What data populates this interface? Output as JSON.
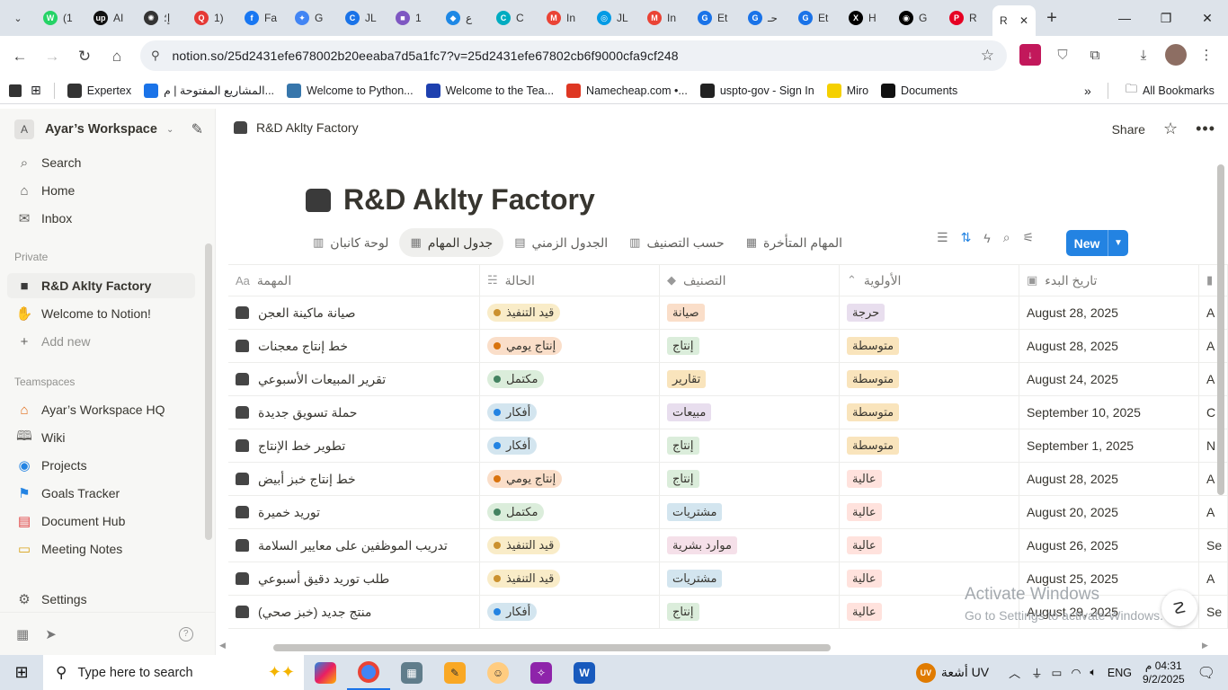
{
  "browser": {
    "tabs": [
      {
        "label": "(1",
        "color": "#25d366",
        "glyph": "W"
      },
      {
        "label": "AI",
        "color": "#111111",
        "glyph": "up"
      },
      {
        "label": "إ؛",
        "color": "#333333",
        "glyph": "✺"
      },
      {
        "label": "1)",
        "color": "#e53935",
        "glyph": "Q"
      },
      {
        "label": "Fa",
        "color": "#1877f2",
        "glyph": "f"
      },
      {
        "label": "G",
        "color": "#4285f4",
        "glyph": "✦"
      },
      {
        "label": "JL",
        "color": "#1a73e8",
        "glyph": "C"
      },
      {
        "label": "1",
        "color": "#7e57c2",
        "glyph": "■"
      },
      {
        "label": "ع",
        "color": "#1e88e5",
        "glyph": "◆"
      },
      {
        "label": "C",
        "color": "#00acc1",
        "glyph": "C"
      },
      {
        "label": "In",
        "color": "#ea4335",
        "glyph": "M"
      },
      {
        "label": "JL",
        "color": "#039be5",
        "glyph": "◎"
      },
      {
        "label": "In",
        "color": "#ea4335",
        "glyph": "M"
      },
      {
        "label": "Et",
        "color": "#1a73e8",
        "glyph": "G"
      },
      {
        "label": "حـ",
        "color": "#1a73e8",
        "glyph": "G"
      },
      {
        "label": "Et",
        "color": "#1a73e8",
        "glyph": "G"
      },
      {
        "label": "H",
        "color": "#000000",
        "glyph": "X"
      },
      {
        "label": "G",
        "color": "#000000",
        "glyph": "◉"
      },
      {
        "label": "R",
        "color": "#e60023",
        "glyph": "P"
      }
    ],
    "active_tab": {
      "label": "R"
    },
    "url": "notion.so/25d2431efe678002b20eeaba7d5a1fc7?v=25d2431efe67802cb6f9000cfa9cf248",
    "bookmarks": [
      {
        "label": "Expertex",
        "color": "#333333"
      },
      {
        "label": "المشاريع المفتوحة | م...",
        "color": "#1a73e8"
      },
      {
        "label": "Welcome to Python...",
        "color": "#3776ab"
      },
      {
        "label": "Welcome to the Tea...",
        "color": "#1e40af"
      },
      {
        "label": "Namecheap.com •...",
        "color": "#de3723"
      },
      {
        "label": "uspto-gov - Sign In",
        "color": "#222222"
      },
      {
        "label": "Miro",
        "color": "#f5d000"
      },
      {
        "label": "Documents",
        "color": "#111111"
      }
    ],
    "all_bookmarks": "All Bookmarks"
  },
  "sidebar": {
    "workspace_avatar": "A",
    "workspace_name": "Ayar’s Workspace",
    "top_items": [
      {
        "label": "Search",
        "icon": "search-icon"
      },
      {
        "label": "Home",
        "icon": "home-icon"
      },
      {
        "label": "Inbox",
        "icon": "inbox-icon"
      }
    ],
    "private_label": "Private",
    "private_items": [
      {
        "label": "R&D Aklty Factory",
        "icon": "database-icon",
        "selected": true
      },
      {
        "label": "Welcome to Notion!",
        "icon": "wave-icon"
      },
      {
        "label": "Add new",
        "icon": "plus-icon"
      }
    ],
    "teamspaces_label": "Teamspaces",
    "teamspace_items": [
      {
        "label": "Ayar’s Workspace HQ",
        "icon": "house-icon"
      },
      {
        "label": "Wiki",
        "icon": "book-icon"
      },
      {
        "label": "Projects",
        "icon": "projects-icon"
      },
      {
        "label": "Goals Tracker",
        "icon": "goals-icon"
      },
      {
        "label": "Document Hub",
        "icon": "document-icon"
      },
      {
        "label": "Meeting Notes",
        "icon": "calendar-icon"
      }
    ],
    "settings": "Settings"
  },
  "page": {
    "breadcrumb": "R&D Aklty Factory",
    "share": "Share",
    "title": "R&D Aklty Factory",
    "views": [
      {
        "label": "لوحة كانبان",
        "active": false
      },
      {
        "label": "جدول المهام",
        "active": true
      },
      {
        "label": "الجدول الزمني",
        "active": false
      },
      {
        "label": "حسب التصنيف",
        "active": false
      },
      {
        "label": "المهام المتأخرة",
        "active": false
      }
    ],
    "new_button": "New",
    "columns": [
      "المهمة",
      "الحالة",
      "التصنيف",
      "الأولوية",
      "تاريخ البدء"
    ],
    "rows": [
      {
        "task": "صيانة ماكينة العجن",
        "status": "قيد التنفيذ",
        "category": "صيانة",
        "priority": "حرجة",
        "start": "August 28, 2025",
        "next": "A"
      },
      {
        "task": "خط إنتاج معجنات",
        "status": "إنتاج يومي",
        "category": "إنتاج",
        "priority": "متوسطة",
        "start": "August 28, 2025",
        "next": "A"
      },
      {
        "task": "تقرير المبيعات الأسبوعي",
        "status": "مكتمل",
        "category": "تقارير",
        "priority": "متوسطة",
        "start": "August 24, 2025",
        "next": "A"
      },
      {
        "task": "حملة تسويق جديدة",
        "status": "أفكار",
        "category": "مبيعات",
        "priority": "متوسطة",
        "start": "September 10, 2025",
        "next": "C"
      },
      {
        "task": "تطوير خط الإنتاج",
        "status": "أفكار",
        "category": "إنتاج",
        "priority": "متوسطة",
        "start": "September 1, 2025",
        "next": "N"
      },
      {
        "task": "خط إنتاج خبز أبيض",
        "status": "إنتاج يومي",
        "category": "إنتاج",
        "priority": "عالية",
        "start": "August 28, 2025",
        "next": "A"
      },
      {
        "task": "توريد خميرة",
        "status": "مكتمل",
        "category": "مشتريات",
        "priority": "عالية",
        "start": "August 20, 2025",
        "next": "A"
      },
      {
        "task": "تدريب الموظفين على معايير السلامة",
        "status": "قيد التنفيذ",
        "category": "موارد بشرية",
        "priority": "عالية",
        "start": "August 26, 2025",
        "next": "Se"
      },
      {
        "task": "طلب توريد دقيق أسبوعي",
        "status": "قيد التنفيذ",
        "category": "مشتريات",
        "priority": "عالية",
        "start": "August 25, 2025",
        "next": "A"
      },
      {
        "task": "منتج جديد (خبز صحي)",
        "status": "أفكار",
        "category": "إنتاج",
        "priority": "عالية",
        "start": "August 29, 2025",
        "next": "Se"
      }
    ],
    "status_styles": {
      "قيد التنفيذ": {
        "bg": "#f9ecc8",
        "dot": "#cb912f"
      },
      "إنتاج يومي": {
        "bg": "#fadec9",
        "dot": "#d9730d"
      },
      "مكتمل": {
        "bg": "#dbeddb",
        "dot": "#448361"
      },
      "أفكار": {
        "bg": "#d3e5ef",
        "dot": "#2383e2"
      }
    },
    "tag_colors": {
      "صيانة": "#fadec9",
      "إنتاج": "#dbeddb",
      "تقارير": "#f9e4bc",
      "مبيعات": "#e8deee",
      "مشتريات": "#d3e5ef",
      "موارد بشرية": "#f5e0e9",
      "حرجة": "#e8deee",
      "متوسطة": "#f9e4bc",
      "عالية": "#ffe2dd"
    },
    "watermark": {
      "line1": "Activate Windows",
      "line2": "Go to Settings to activate Windows."
    }
  },
  "taskbar": {
    "search_placeholder": "Type here to search",
    "weather": "أشعة UV",
    "weather_badge": "UV",
    "lang": "ENG",
    "time": "04:31 م",
    "date": "9/2/2025"
  }
}
